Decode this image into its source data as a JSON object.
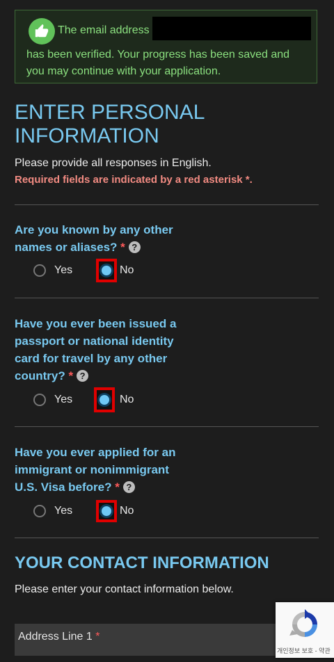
{
  "verification": {
    "line1": "The email address",
    "line2": "has been verified. Your progress has been saved and you may continue with your application."
  },
  "section_personal": {
    "title": "ENTER PERSONAL INFORMATION",
    "intro": "Please provide all responses in English.",
    "required_note": "Required fields are indicated by a red asterisk *."
  },
  "questions": [
    {
      "text": "Are you known by any other names or aliases?",
      "options": [
        "Yes",
        "No"
      ],
      "selected": "No"
    },
    {
      "text": "Have you ever been issued a passport or national identity card for travel by any other country?",
      "options": [
        "Yes",
        "No"
      ],
      "selected": "No"
    },
    {
      "text": "Have you ever applied for an immigrant or nonimmigrant U.S. Visa before?",
      "options": [
        "Yes",
        "No"
      ],
      "selected": "No"
    }
  ],
  "asterisk": "*",
  "help_glyph": "?",
  "section_contact": {
    "title": "YOUR CONTACT INFORMATION",
    "intro": "Please enter your contact information below.",
    "address_line1_label": "Address Line 1"
  },
  "recaptcha": {
    "footer": "개인정보 보호 - 약관"
  },
  "colors": {
    "accent": "#79c9f0",
    "success": "#8be07f",
    "required": "#f28b82",
    "highlight": "#e00000"
  }
}
